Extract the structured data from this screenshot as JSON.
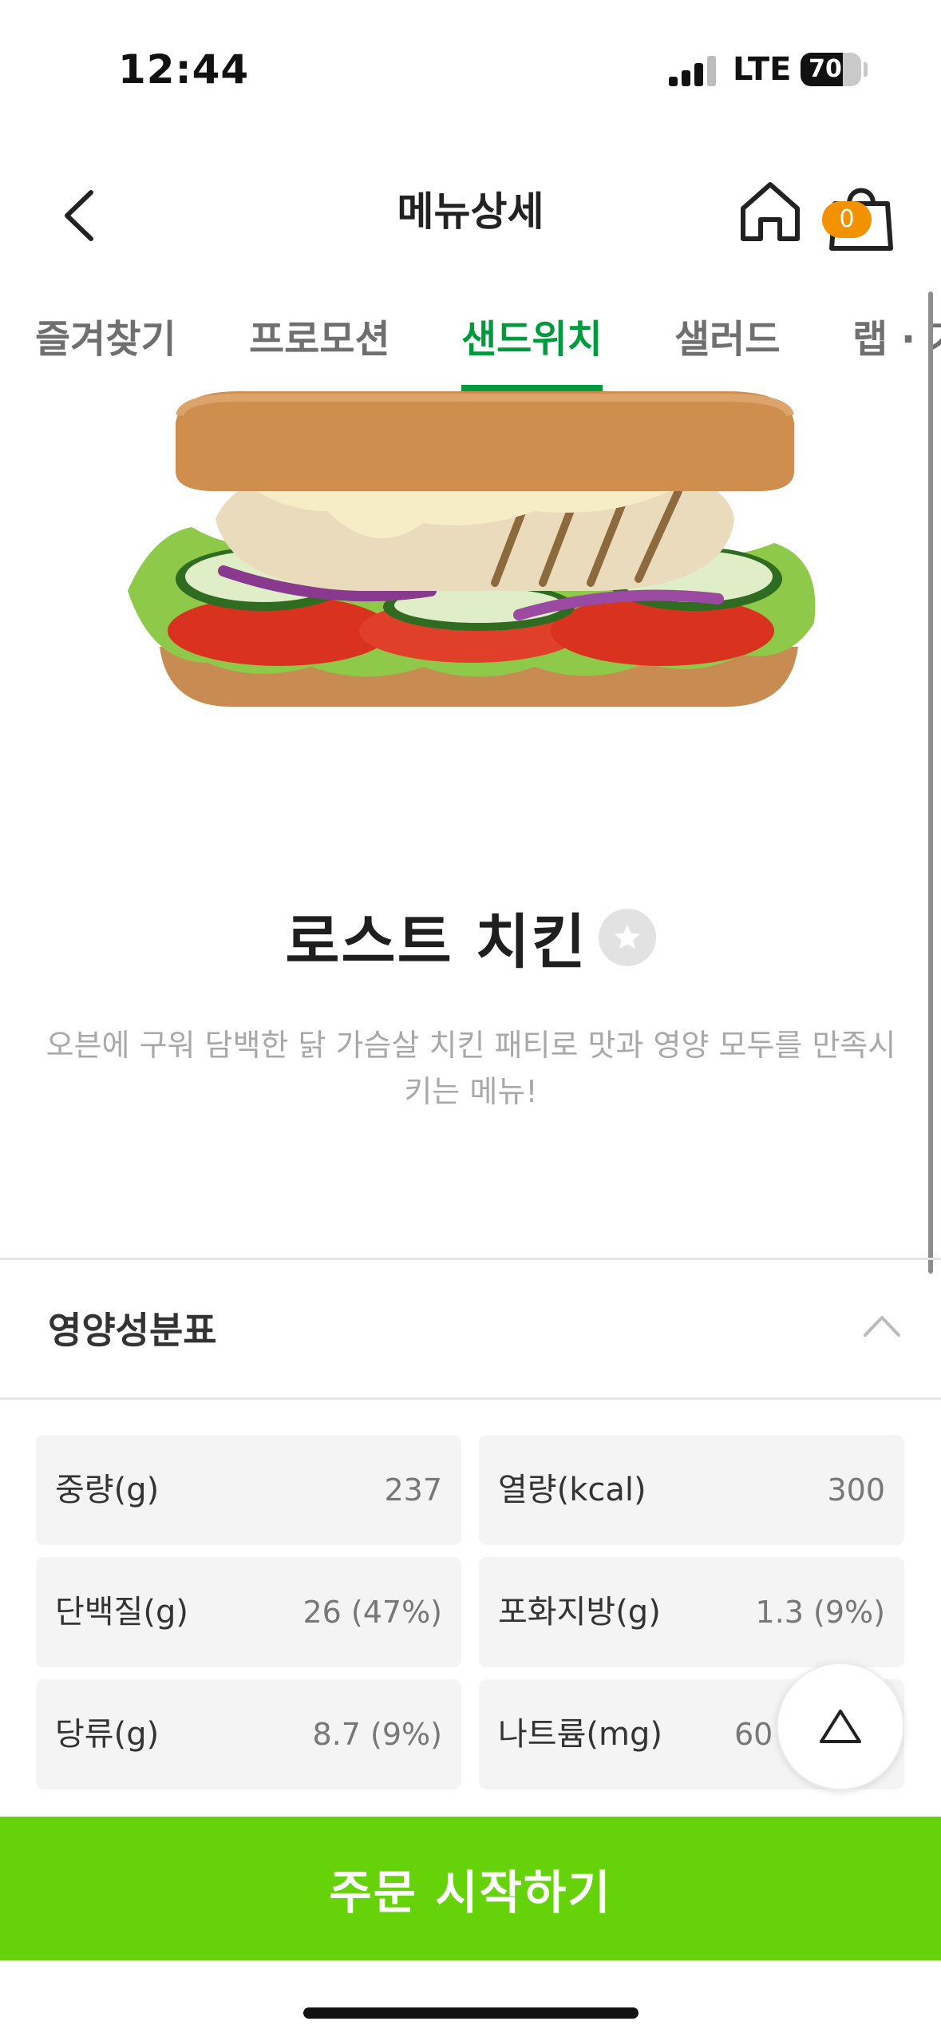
{
  "status_bar": {
    "time": "12:44",
    "network": "LTE",
    "battery": "70",
    "battery_level": 0.7
  },
  "header": {
    "title": "메뉴상세",
    "cart_count": "0",
    "back_icon": "chevron-left-icon",
    "home_icon": "home-icon",
    "cart_icon": "shopping-bag-icon"
  },
  "tabs": [
    {
      "label": "즐겨찾기",
      "active": false
    },
    {
      "label": "프로모션",
      "active": false
    },
    {
      "label": "샌드위치",
      "active": true
    },
    {
      "label": "샐러드",
      "active": false
    },
    {
      "label": "랩 · 기",
      "active": false
    }
  ],
  "product": {
    "name": "로스트 치킨",
    "description": "오븐에 구워 담백한 닭 가슴살 치킨 패티로 맛과 영양 모두를 만족시키는 메뉴!"
  },
  "nutrition": {
    "title": "영양성분표",
    "items": [
      {
        "label": "중량(g)",
        "value": "237"
      },
      {
        "label": "열량(kcal)",
        "value": "300"
      },
      {
        "label": "단백질(g)",
        "value": "26 (47%)"
      },
      {
        "label": "포화지방(g)",
        "value": "1.3 (9%)"
      },
      {
        "label": "당류(g)",
        "value": "8.7 (9%)"
      },
      {
        "label": "나트륨(mg)",
        "value": "60"
      }
    ]
  },
  "order_button": "주문 시작하기",
  "colors": {
    "brand_green": "#009a3e",
    "cta_green": "#65d20a",
    "badge_orange": "#f39200"
  }
}
